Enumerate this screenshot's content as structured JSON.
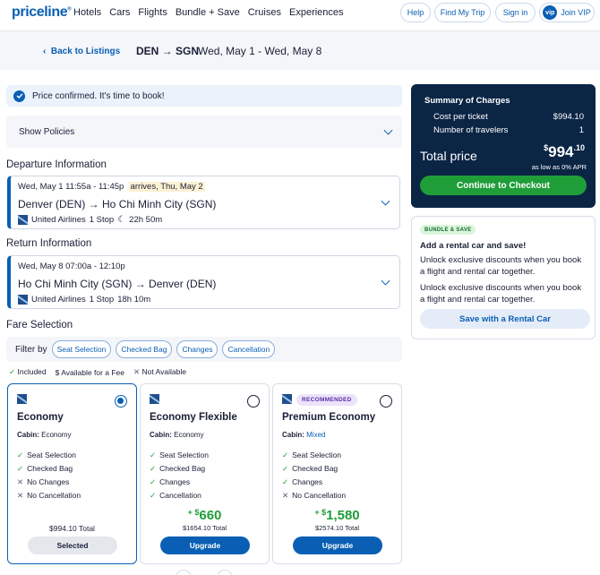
{
  "nav": {
    "logo": "priceline",
    "links": [
      "Hotels",
      "Cars",
      "Flights",
      "Bundle + Save",
      "Cruises",
      "Experiences"
    ],
    "help": "Help",
    "find_trip": "Find My Trip",
    "sign_in": "Sign in",
    "vip_badge": "vip",
    "join_vip": "Join VIP"
  },
  "breadcrumb": {
    "back": "Back to Listings",
    "route": "DEN → SGN",
    "dates": "Wed, May 1 - Wed, May 8"
  },
  "confirm_text": "Price confirmed. It's time to book!",
  "policies_label": "Show Policies",
  "departure": {
    "title": "Departure Information",
    "date_time": "Wed, May 1   11:55a - 11:45p",
    "arrives": "arrives, Thu, May 2",
    "route": "Denver (DEN)  →  Ho Chi Minh City (SGN)",
    "airline": "United Airlines",
    "stops": "1 Stop",
    "duration": "22h 50m"
  },
  "return": {
    "title": "Return Information",
    "date_time": "Wed, May 8   07:00a - 12:10p",
    "route": "Ho Chi Minh City (SGN)  →  Denver (DEN)",
    "airline": "United Airlines",
    "stops": "1 Stop",
    "duration": "18h 10m"
  },
  "fare": {
    "title": "Fare Selection",
    "filter_label": "Filter by",
    "filters": [
      "Seat Selection",
      "Checked Bag",
      "Changes",
      "Cancellation"
    ],
    "legend": {
      "included": "Included",
      "fee": "Available for a Fee",
      "not_available": "Not Available"
    },
    "cards": [
      {
        "name": "Economy",
        "cabin_label": "Cabin:",
        "cabin": "Economy",
        "features": [
          {
            "ok": true,
            "text": "Seat Selection"
          },
          {
            "ok": true,
            "text": "Checked Bag"
          },
          {
            "ok": false,
            "text": "No Changes"
          },
          {
            "ok": false,
            "text": "No Cancellation"
          }
        ],
        "total": "$994.10 Total",
        "button": "Selected"
      },
      {
        "name": "Economy Flexible",
        "cabin_label": "Cabin:",
        "cabin": "Economy",
        "features": [
          {
            "ok": true,
            "text": "Seat Selection"
          },
          {
            "ok": true,
            "text": "Checked Bag"
          },
          {
            "ok": true,
            "text": "Changes"
          },
          {
            "ok": true,
            "text": "Cancellation"
          }
        ],
        "plus_sign": "+ $",
        "plus_amount": "660",
        "total": "$1654.10 Total",
        "button": "Upgrade"
      },
      {
        "badge": "RECOMMENDED",
        "name": "Premium Economy",
        "cabin_label": "Cabin:",
        "cabin": "Mixed",
        "features": [
          {
            "ok": true,
            "text": "Seat Selection"
          },
          {
            "ok": true,
            "text": "Checked Bag"
          },
          {
            "ok": true,
            "text": "Changes"
          },
          {
            "ok": false,
            "text": "No Cancellation"
          }
        ],
        "plus_sign": "+ $",
        "plus_amount": "1,580",
        "total": "$2574.10 Total",
        "button": "Upgrade"
      }
    ]
  },
  "summary": {
    "title": "Summary of Charges",
    "cost_label": "Cost per ticket",
    "cost_value": "$994.10",
    "travelers_label": "Number of travelers",
    "travelers_value": "1",
    "total_label": "Total price",
    "total_dollar": "$",
    "total_main": "994",
    "total_cents": ".10",
    "apr": "as low as 0% APR",
    "checkout": "Continue to Checkout"
  },
  "bundle": {
    "tag": "BUNDLE & SAVE",
    "heading": "Add a rental car and save!",
    "p1": "Unlock exclusive discounts when you book a flight and rental car together.",
    "p2": "Unlock exclusive discounts when you book a flight and rental car together.",
    "button": "Save with a Rental Car"
  },
  "colors": {
    "brand_blue": "#0a5fb4",
    "navy": "#0b2545",
    "green": "#1f9d39"
  }
}
